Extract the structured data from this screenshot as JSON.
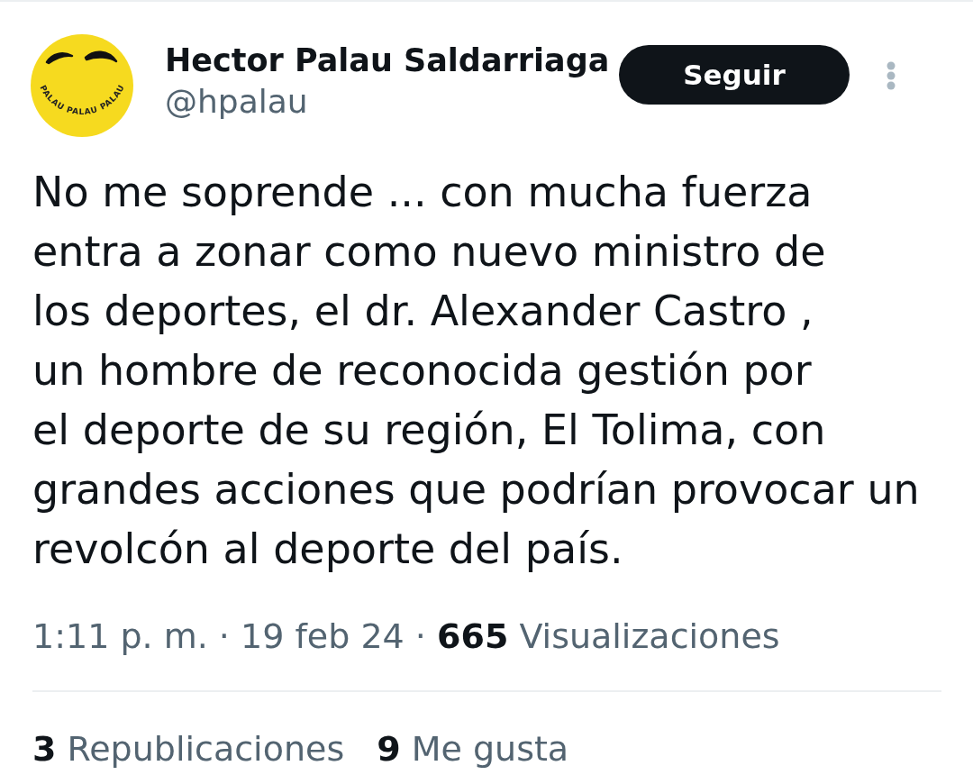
{
  "tweet": {
    "author": {
      "name": "Hector Palau Saldarriaga",
      "handle": "@hpalau",
      "avatar_caption": "PALAU PALAU PALAU"
    },
    "follow_button": {
      "label": "Seguir"
    },
    "text": "No me soprende ... con mucha fuerza\nentra a zonar como nuevo ministro de\nlos deportes, el dr. Alexander Castro ,\nun hombre de reconocida gestión por\nel deporte de su región, El Tolima, con\ngrandes acciones que podrían provocar un\nrevolcón al deporte del país.",
    "meta": "1:11 p. m. · 19 feb 24 · **665** Visualizaciones",
    "stats": [
      {
        "count": "3",
        "label": "Republicaciones"
      },
      {
        "count": "9",
        "label": "Me gusta"
      }
    ]
  }
}
